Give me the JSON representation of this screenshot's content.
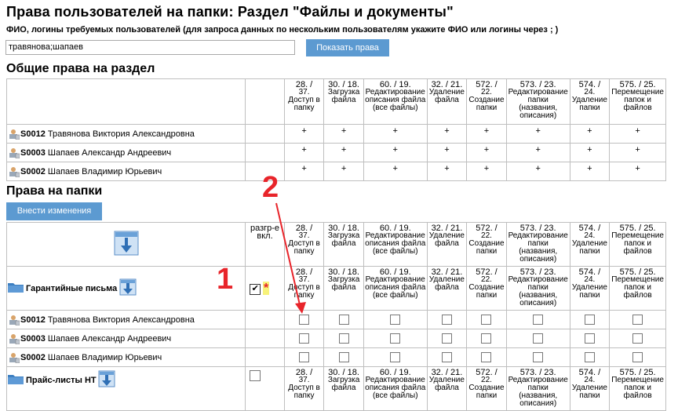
{
  "title": "Права пользователей на папки: Раздел \"Файлы и документы\"",
  "hint": "ФИО, логины требуемых пользователей (для запроса данных по нескольким пользователям укажите ФИО или логины через ; )",
  "search_value": "травянова;шапаев",
  "show_button": "Показать права",
  "section1_title": "Общие права на раздел",
  "section2_title": "Права на папки",
  "apply_button": "Внести изменения",
  "col_header_extra": "разгр-е вкл.",
  "columns": [
    {
      "n": "28. /",
      "t": "37. Доступ в папку"
    },
    {
      "n": "30. / 18.",
      "t": "Загрузка файла"
    },
    {
      "n": "60. / 19.",
      "t": "Редактирование описания файла (все файлы)"
    },
    {
      "n": "32. / 21.",
      "t": "Удаление файла"
    },
    {
      "n": "572. /",
      "t": "22. Создание папки"
    },
    {
      "n": "573. / 23.",
      "t": "Редактирование папки (названия, описания)"
    },
    {
      "n": "574. /",
      "t": "24. Удаление папки"
    },
    {
      "n": "575. / 25.",
      "t": "Перемещение папок и файлов"
    }
  ],
  "users": [
    {
      "code": "S0012",
      "name": "Травянова Виктория Александровна"
    },
    {
      "code": "S0003",
      "name": "Шапаев Александр Андреевич"
    },
    {
      "code": "S0002",
      "name": "Шапаев Владимир Юрьевич"
    }
  ],
  "plus": "+",
  "folders": [
    {
      "name": "Гарантийные письма"
    },
    {
      "name": "Прайс-листы НТ"
    }
  ],
  "annotation_1": "1",
  "annotation_2": "2",
  "star": "*",
  "check": "✔",
  "colors": {
    "button": "#5c9ad1",
    "annotation": "#e8242a",
    "highlight": "#f7f27a"
  }
}
